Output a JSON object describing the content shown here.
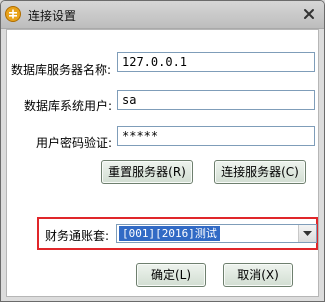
{
  "window": {
    "title": "连接设置",
    "icons": {
      "app": "app-logo-icon",
      "close": "close-icon"
    }
  },
  "form": {
    "server_name_label": "数据库服务器名称:",
    "server_name_value": "127.0.0.1",
    "user_label": "数据库系统用户:",
    "user_value": "sa",
    "password_label": "用户密码验证:",
    "password_value": "*****"
  },
  "buttons": {
    "reset_server": "重置服务器(R)",
    "connect_server": "连接服务器(C)",
    "ok": "确定(L)",
    "cancel": "取消(X)"
  },
  "account": {
    "label": "财务通账套:",
    "selected": "[001][2016]测试",
    "arrow_icon": "chevron-down-icon"
  },
  "colors": {
    "highlight_border": "#e0262a",
    "selection": "#316ac5"
  }
}
